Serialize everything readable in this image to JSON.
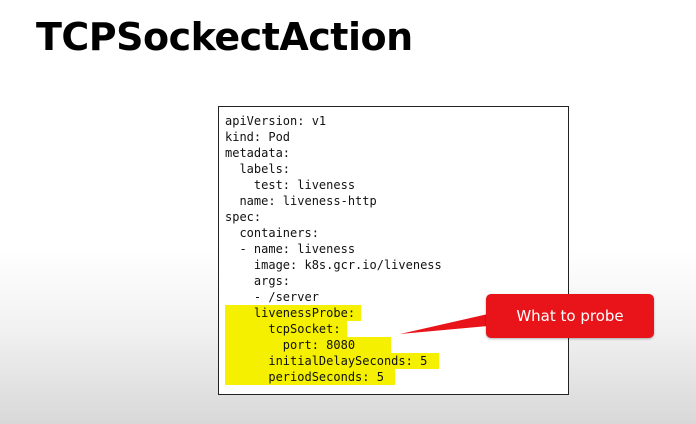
{
  "slide": {
    "title": "TCPSockectAction"
  },
  "code": {
    "lines": [
      "apiVersion: v1",
      "kind: Pod",
      "metadata:",
      "  labels:",
      "    test: liveness",
      "  name: liveness-http",
      "spec:",
      "  containers:",
      "  - name: liveness",
      "    image: k8s.gcr.io/liveness",
      "    args:",
      "    - /server",
      "    livenessProbe:",
      "      tcpSocket:",
      "        port: 8080",
      "      initialDelaySeconds: 5",
      "      periodSeconds: 5"
    ],
    "highlight_color": "#f4f000"
  },
  "callout": {
    "label": "What to probe",
    "color": "#e8141a"
  }
}
